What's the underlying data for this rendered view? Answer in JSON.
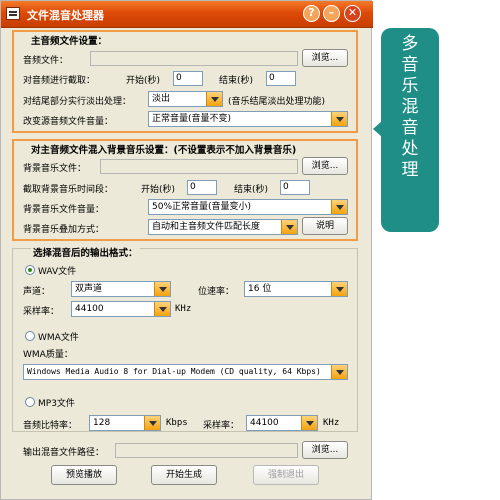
{
  "window": {
    "title": "文件混音处理器",
    "controls": {
      "help": "?",
      "minimize": "–",
      "close": "✕"
    }
  },
  "main_audio": {
    "title": "主音频文件设置：",
    "file_label": "音频文件：",
    "file_value": "",
    "browse": "浏览...",
    "clip_label": "对音频进行截取：",
    "start_label": "开始(秒)",
    "start_value": "0",
    "end_label": "结束(秒)",
    "end_value": "0",
    "fade_label": "对结尾部分实行淡出处理：",
    "fade_value": "淡出",
    "fade_note": "(音乐结尾淡出处理功能)",
    "volume_label": "改变源音频文件音量：",
    "volume_value": "正常音量(音量不变)"
  },
  "background": {
    "title": "对主音频文件混入背景音乐设置：(不设置表示不加入背景音乐)",
    "file_label": "背景音乐文件：",
    "file_value": "",
    "browse": "浏览...",
    "clip_label": "截取背景音乐时间段：",
    "start_label": "开始(秒)",
    "start_value": "0",
    "end_label": "结束(秒)",
    "end_value": "0",
    "volume_label": "背景音乐文件音量：",
    "volume_value": "50%正常音量(音量变小)",
    "mode_label": "背景音乐叠加方式：",
    "mode_value": "自动和主音频文件匹配长度",
    "help_button": "说明"
  },
  "output": {
    "title": "选择混音后的输出格式：",
    "wav": {
      "label": "WAV文件",
      "selected": true,
      "channel_label": "声道：",
      "channel_value": "双声道",
      "bitdepth_label": "位速率：",
      "bitdepth_value": "16 位",
      "samplerate_label": "采样率：",
      "samplerate_value": "44100",
      "samplerate_unit": "KHz"
    },
    "wma": {
      "label": "WMA文件",
      "selected": false,
      "quality_label": "WMA质量：",
      "quality_value": "Windows Media Audio 8 for Dial-up Modem (CD quality, 64 Kbps)"
    },
    "mp3": {
      "label": "MP3文件",
      "selected": false,
      "bitrate_label": "音频比特率：",
      "bitrate_value": "128",
      "bitrate_unit": "Kbps",
      "samplerate_label": "采样率：",
      "samplerate_value": "44100",
      "samplerate_unit": "KHz"
    },
    "path_label": "输出混音文件路径：",
    "path_value": "",
    "browse": "浏览..."
  },
  "actions": {
    "preview": "预览播放",
    "start": "开始生成",
    "force_exit": "强制退出"
  },
  "callout": {
    "text": "多音乐混音处理"
  },
  "colors": {
    "title_bar": "#e05a10",
    "frame_border": "#f29a44",
    "callout": "#1f8e86",
    "combo_arrow": "#f3a20f"
  }
}
